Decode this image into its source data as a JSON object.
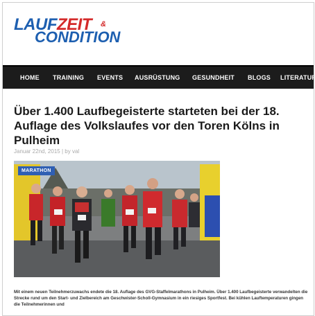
{
  "logo": {
    "line1_a": "LAUF",
    "line1_b": "ZEIT",
    "amp": "&",
    "line2": "CONDITION"
  },
  "nav": {
    "items": [
      "HOME",
      "TRAINING",
      "EVENTS",
      "AUSRÜSTUNG",
      "GESUNDHEIT",
      "BLOGS",
      "LITERATUR"
    ]
  },
  "article": {
    "title": "Über 1.400 Laufbegeisterte starteten bei der 18. Auflage des Volkslaufes vor den Toren Kölns in Pulheim",
    "date": "Januar 22nd, 2015",
    "separator": "| by",
    "author": "val",
    "category_badge": "MARATHON",
    "body": "Mit einem neuen Teilnehmerzuwachs endete die 18. Auflage des GVG-Staffelmarathons in Pulheim. Über 1.400 Laufbegeisterte verwandelten die Strecke rund um den Start- und Zielbereich am Geschwister-Scholl-Gymnasium in ein riesiges Sportfest. Bei kühlen Lauftemperaturen gingen die Teilnehmerinnen und"
  },
  "colors": {
    "logo_blue": "#1d5fb0",
    "logo_red": "#d42a2a",
    "nav_bg": "#1c1c1c",
    "badge_blue": "#2f5fb3"
  }
}
